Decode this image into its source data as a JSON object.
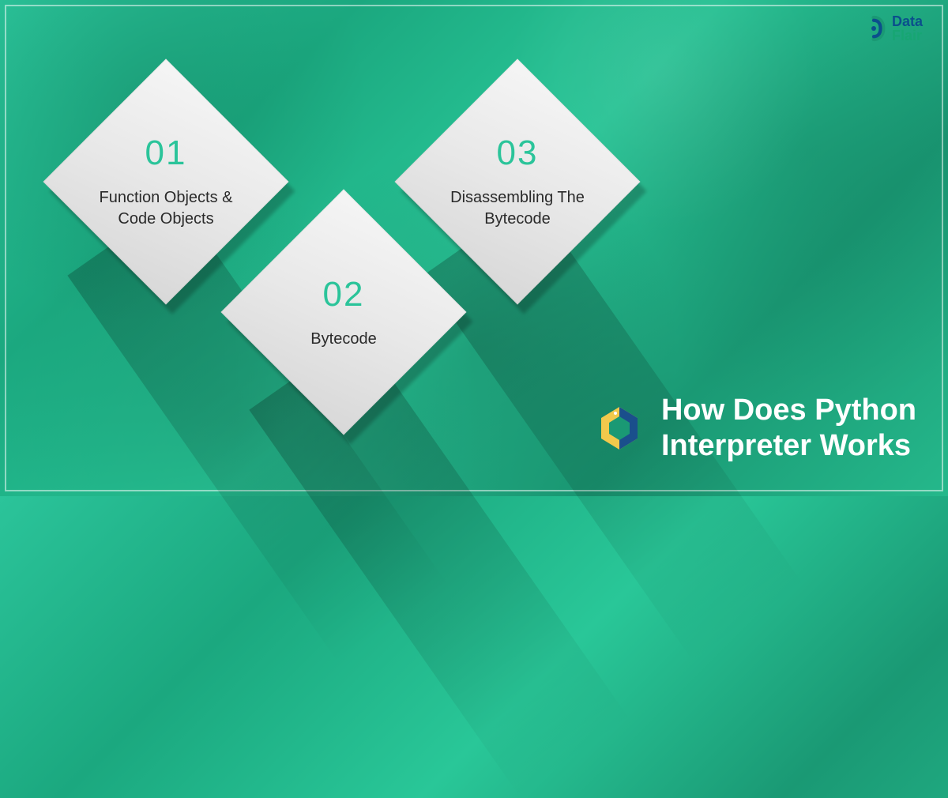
{
  "logo": {
    "line1": "Data",
    "line2": "Flair"
  },
  "items": [
    {
      "num": "01",
      "label": "Function Objects & Code Objects"
    },
    {
      "num": "02",
      "label": "Bytecode"
    },
    {
      "num": "03",
      "label": "Disassembling The Bytecode"
    }
  ],
  "title": {
    "line1": "How Does Python",
    "line2": "Interpreter Works"
  }
}
